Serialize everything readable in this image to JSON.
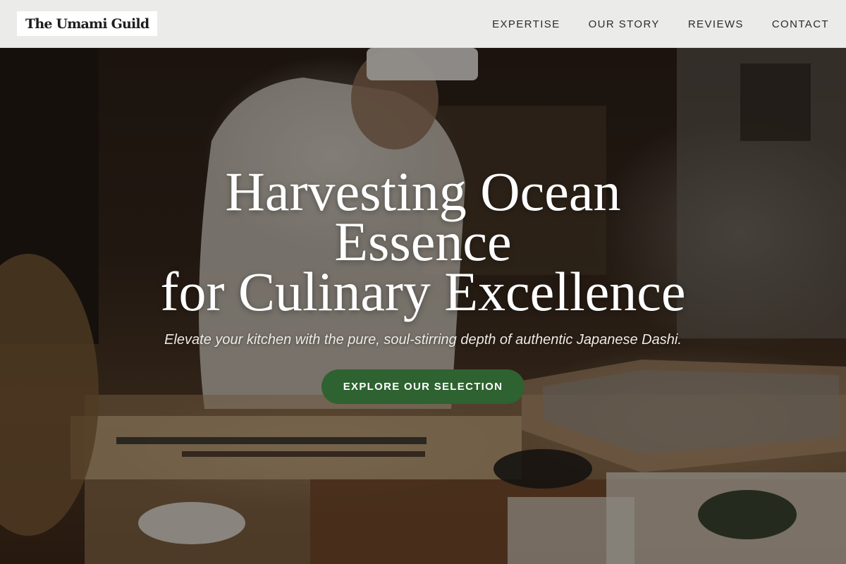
{
  "brand": {
    "logo_text": "The Umami Guild"
  },
  "nav": {
    "items": [
      {
        "label": "EXPERTISE"
      },
      {
        "label": "OUR STORY"
      },
      {
        "label": "REVIEWS"
      },
      {
        "label": "CONTACT"
      }
    ]
  },
  "hero": {
    "headline_lines": [
      "Harvesting Ocean",
      "Essence",
      "for Culinary Excellence"
    ],
    "subtitle": "Elevate your kitchen with the pure, soul-stirring depth of authentic Japanese Dashi.",
    "cta_label": "EXPLORE OUR SELECTION",
    "image": "chef-preparing-food-at-counter-photo"
  },
  "colors": {
    "cta_background": "#2e6230",
    "nav_background": "#f4f5f2",
    "headline_text": "#ffffff"
  }
}
